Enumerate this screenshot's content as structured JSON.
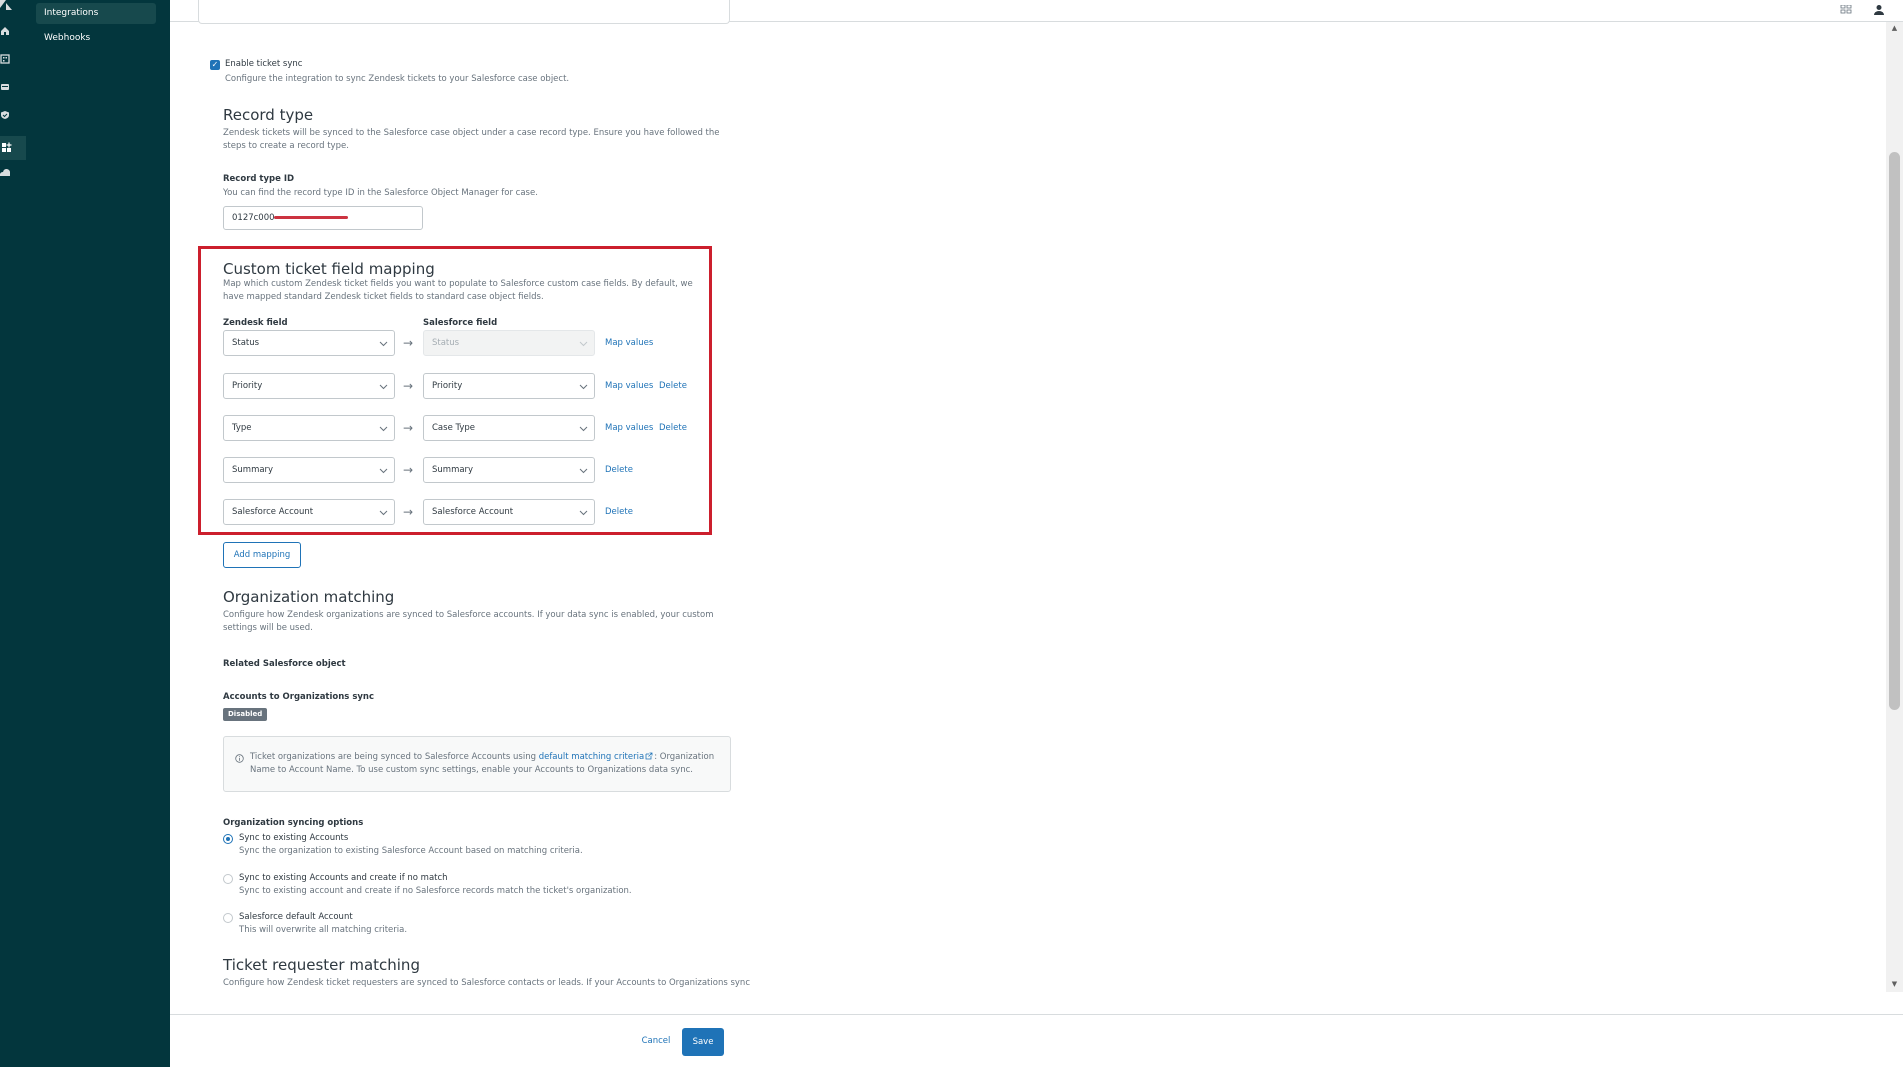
{
  "nav": {
    "items": [
      {
        "label": "Integrations",
        "active": true
      },
      {
        "label": "Webhooks",
        "active": false
      }
    ]
  },
  "sync": {
    "enable_label": "Enable ticket sync",
    "enable_checked": true,
    "enable_desc": "Configure the integration to sync Zendesk tickets to your Salesforce case object."
  },
  "record_type": {
    "title": "Record type",
    "desc": "Zendesk tickets will be synced to the Salesforce case object under a case record type. Ensure you have followed the steps to create a record type.",
    "id_label": "Record type ID",
    "id_desc": "You can find the record type ID in the Salesforce Object Manager for case.",
    "id_value": "0127c000"
  },
  "mapping": {
    "title": "Custom ticket field mapping",
    "desc": "Map which custom Zendesk ticket fields you want to populate to Salesforce custom case fields. By default, we have mapped standard Zendesk ticket fields to standard case object fields.",
    "col_zendesk": "Zendesk field",
    "col_salesforce": "Salesforce field",
    "arrow": "→",
    "rows": [
      {
        "zendesk": "Status",
        "salesforce": "Status",
        "map_values": "Map values",
        "delete": ""
      },
      {
        "zendesk": "Priority",
        "salesforce": "Priority",
        "map_values": "Map values",
        "delete": "Delete"
      },
      {
        "zendesk": "Type",
        "salesforce": "Case Type",
        "map_values": "Map values",
        "delete": "Delete"
      },
      {
        "zendesk": "Summary",
        "salesforce": "Summary",
        "map_values": "",
        "delete": "Delete"
      },
      {
        "zendesk": "Salesforce Account",
        "salesforce": "Salesforce Account",
        "map_values": "",
        "delete": "Delete"
      }
    ],
    "add_label": "Add mapping"
  },
  "org": {
    "title": "Organization matching",
    "desc": "Configure how Zendesk organizations are synced to Salesforce accounts. If your data sync is enabled, your custom settings will be used.",
    "related_label": "Related Salesforce object",
    "sync_label": "Accounts to Organizations sync",
    "sync_badge": "Disabled",
    "info_prefix": "Ticket organizations are being synced to Salesforce Accounts using ",
    "info_link": "default matching criteria",
    "info_suffix": ": Organization",
    "info_line2": "Name to Account Name. To use custom sync settings, enable your Accounts to Organizations data sync.",
    "options_label": "Organization syncing options",
    "options": [
      {
        "label": "Sync to existing Accounts",
        "desc": "Sync the organization to existing Salesforce Account based on matching criteria.",
        "checked": true
      },
      {
        "label": "Sync to existing Accounts and create if no match",
        "desc": "Sync to existing account and create if no Salesforce records match the ticket's organization.",
        "checked": false
      },
      {
        "label": "Salesforce default Account",
        "desc": "This will overwrite all matching criteria.",
        "checked": false
      }
    ]
  },
  "requester": {
    "title": "Ticket requester matching",
    "desc": "Configure how Zendesk ticket requesters are synced to Salesforce contacts or leads. If your Accounts to Organizations sync"
  },
  "footer": {
    "cancel_label": "Cancel",
    "save_label": "Save"
  },
  "colors": {
    "sidebar": "#03363d",
    "accent": "#1f73b7",
    "highlight": "#cc1f2d"
  }
}
